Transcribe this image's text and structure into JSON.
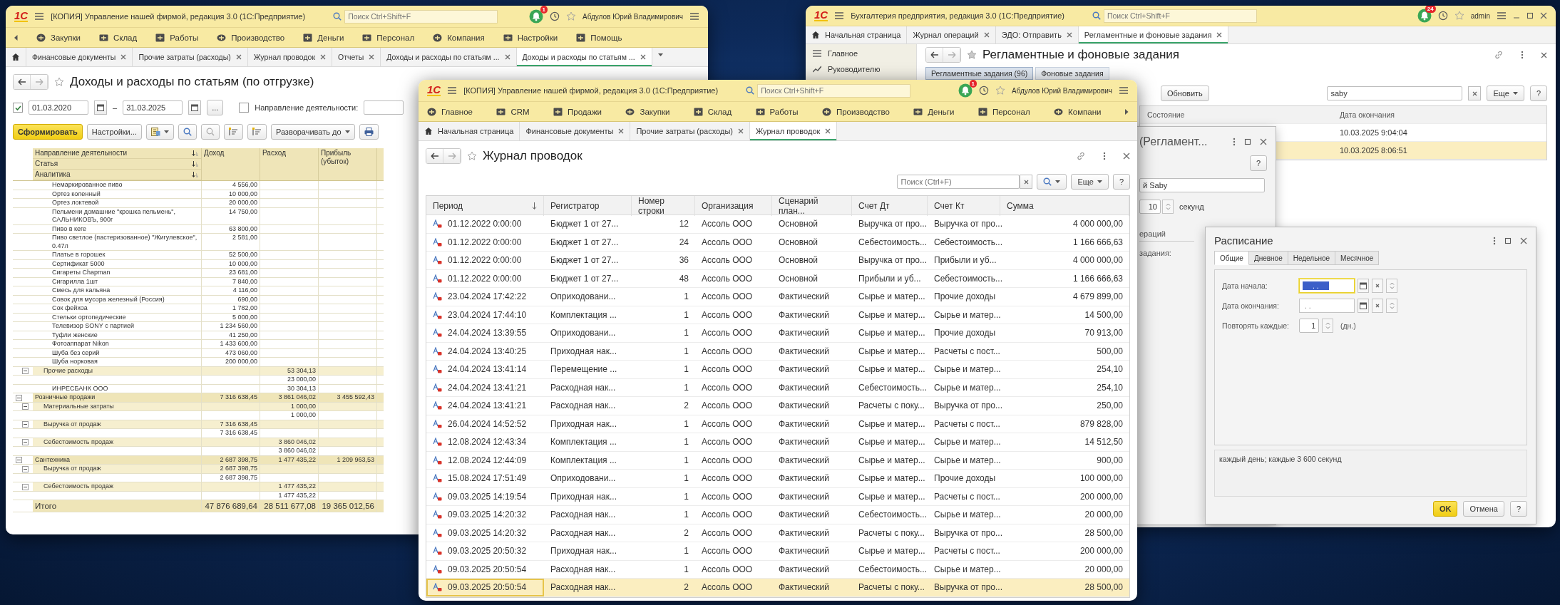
{
  "left_window": {
    "logo": "1С",
    "title": "[КОПИЯ] Управление нашей фирмой, редакция 3.0  (1С:Предприятие)",
    "search": {
      "placeholder": "Поиск Ctrl+Shift+F"
    },
    "notifications": "1",
    "user": "Абдулов Юрий Владимирович",
    "sections": [
      "Закупки",
      "Склад",
      "Работы",
      "Производство",
      "Деньги",
      "Персонал",
      "Компания",
      "Настройки",
      "Помощь"
    ],
    "tabs": [
      {
        "label": "Финансовые документы",
        "selected": false
      },
      {
        "label": "Прочие затраты (расходы)",
        "selected": false
      },
      {
        "label": "Журнал проводок",
        "selected": false
      },
      {
        "label": "Отчеты",
        "selected": false
      },
      {
        "label": "Доходы и расходы по статьям ...",
        "selected": false
      },
      {
        "label": "Доходы и расходы по статьям ...",
        "selected": true
      }
    ],
    "form_title": "Доходы и расходы по статьям (по отгрузке)",
    "period": {
      "checked": true,
      "start": "01.03.2020",
      "separator": "–",
      "end": "31.03.2025",
      "choose": "..."
    },
    "filter": {
      "checked": false,
      "label": "Направление деятельности:"
    },
    "toolbar": {
      "generate": "Сформировать",
      "settings": "Настройки...",
      "expand": "Разворачивать до"
    },
    "report": {
      "groupings": [
        "Направление деятельности",
        "Статья",
        "Аналитика"
      ],
      "columns": [
        "Доход",
        "Расход",
        "Прибыль (убыток)"
      ],
      "rows": [
        {
          "children": [
            {
              "children": [
                {
                  "label": "Немаркированное пиво",
                  "income": "4 556,00"
                },
                {
                  "label": "Ортез коленный",
                  "income": "10 000,00"
                },
                {
                  "label": "Ортез локтевой",
                  "income": "20 000,00"
                },
                {
                  "label": "Пельмени домашние \"крошка пельмень\", САЛЬНИКОВЪ, 900г",
                  "income": "14 750,00"
                },
                {
                  "label": "Пиво в кеге",
                  "income": "63 800,00"
                },
                {
                  "label": "Пиво светлое (пастеризованное) \"Жигулевское\", 0.47л",
                  "income": "2 581,00"
                },
                {
                  "label": "Платье в горошек",
                  "income": "52 500,00"
                },
                {
                  "label": "Сертификат 5000",
                  "income": "10 000,00"
                },
                {
                  "label": "Сигареты Chapman",
                  "income": "23 681,00"
                },
                {
                  "label": "Сигарилла 1шт",
                  "income": "7 840,00"
                },
                {
                  "label": "Смесь для кальяна",
                  "income": "4 116,00"
                },
                {
                  "label": "Совок для мусора железный (Россия)",
                  "income": "690,00"
                },
                {
                  "label": "Сок фейхоа",
                  "income": "1 782,00"
                },
                {
                  "label": "Стельки ортопедические",
                  "income": "5 000,00"
                },
                {
                  "label": "Телевизор SONY с партией",
                  "income": "1 234 560,00"
                },
                {
                  "label": "Туфли женские",
                  "income": "41 250,00"
                },
                {
                  "label": "Фотоаппарат Nikon",
                  "income": "1 433 600,00"
                },
                {
                  "label": "Шуба без серий",
                  "income": "473 060,00"
                },
                {
                  "label": "Шуба норковая",
                  "income": "200 000,00"
                }
              ]
            },
            {
              "label": "Прочие расходы",
              "expense": "53 304,13",
              "expanded": true,
              "children": [
                {
                  "expense": "23 000,00"
                },
                {
                  "label": "ИНРЕСБАНК ООО",
                  "expense": "30 304,13"
                }
              ]
            }
          ]
        },
        {
          "label": "Розничные продажи",
          "income": "7 316 638,45",
          "expense": "3 861 046,02",
          "profit": "3 455 592,43",
          "expanded": true,
          "children": [
            {
              "label": "Материальные затраты",
              "expense": "1 000,00",
              "expanded": true,
              "children": [
                {
                  "expense": "1 000,00"
                }
              ]
            },
            {
              "label": "Выручка от продаж",
              "income": "7 316 638,45",
              "expanded": true,
              "children": [
                {
                  "income": "7 316 638,45"
                }
              ]
            },
            {
              "label": "Себестоимость продаж",
              "expense": "3 860 046,02",
              "expanded": true,
              "children": [
                {
                  "expense": "3 860 046,02"
                }
              ]
            }
          ]
        },
        {
          "label": "Сантехника",
          "income": "2 687 398,75",
          "expense": "1 477 435,22",
          "profit": "1 209 963,53",
          "expanded": true,
          "children": [
            {
              "label": "Выручка от продаж",
              "income": "2 687 398,75",
              "expanded": true,
              "children": [
                {
                  "income": "2 687 398,75"
                }
              ]
            },
            {
              "label": "Себестоимость продаж",
              "expense": "1 477 435,22",
              "expanded": true,
              "children": [
                {
                  "expense": "1 477 435,22"
                }
              ]
            }
          ]
        }
      ],
      "total": {
        "label": "Итого",
        "income": "47 876 689,64",
        "expense": "28 511 677,08",
        "profit": "19 365 012,56"
      }
    }
  },
  "central_window": {
    "logo": "1С",
    "title": "[КОПИЯ] Управление нашей фирмой, редакция 3.0  (1С:Предприятие)",
    "search": {
      "placeholder": "Поиск Ctrl+Shift+F"
    },
    "notifications": "1",
    "user": "Абдулов Юрий Владимирович",
    "sections": [
      "Главное",
      "CRM",
      "Продажи",
      "Закупки",
      "Склад",
      "Работы",
      "Производство",
      "Деньги",
      "Персонал",
      "Компани"
    ],
    "home_tab": "Начальная страница",
    "tabs": [
      {
        "label": "Финансовые документы",
        "selected": false
      },
      {
        "label": "Прочие затраты (расходы)",
        "selected": false
      },
      {
        "label": "Журнал проводок",
        "selected": true
      }
    ],
    "form_title": "Журнал проводок",
    "list_search": {
      "placeholder": "Поиск (Ctrl+F)"
    },
    "more": "Еще",
    "help": "?",
    "columns": [
      {
        "label": "Период",
        "sorted": true
      },
      {
        "label": "Регистратор"
      },
      {
        "label": "Номер строки"
      },
      {
        "label": "Организация"
      },
      {
        "label": "Сценарий план..."
      },
      {
        "label": "Счет Дт"
      },
      {
        "label": "Счет Кт"
      },
      {
        "label": "Сумма"
      }
    ],
    "rows": [
      {
        "cells": [
          "01.12.2022 0:00:00",
          "Бюджет 1 от 27...",
          "12",
          "Ассоль ООО",
          "Основной",
          "Выручка от про...",
          "Выручка от про...",
          "4 000 000,00"
        ],
        "selected": false
      },
      {
        "cells": [
          "01.12.2022 0:00:00",
          "Бюджет 1 от 27...",
          "24",
          "Ассоль ООО",
          "Основной",
          "Себестоимость...",
          "Себестоимость...",
          "1 166 666,63"
        ],
        "selected": false
      },
      {
        "cells": [
          "01.12.2022 0:00:00",
          "Бюджет 1 от 27...",
          "36",
          "Ассоль ООО",
          "Основной",
          "Выручка от про...",
          "Прибыли и уб...",
          "4 000 000,00"
        ],
        "selected": false
      },
      {
        "cells": [
          "01.12.2022 0:00:00",
          "Бюджет 1 от 27...",
          "48",
          "Ассоль ООО",
          "Основной",
          "Прибыли и уб...",
          "Себестоимость...",
          "1 166 666,63"
        ],
        "selected": false
      },
      {
        "cells": [
          "23.04.2024 17:42:22",
          "Оприходовани...",
          "1",
          "Ассоль ООО",
          "Фактический",
          "Сырье и матер...",
          "Прочие доходы",
          "4 679 899,00"
        ],
        "selected": false
      },
      {
        "cells": [
          "23.04.2024 17:44:10",
          "Комплектация ...",
          "1",
          "Ассоль ООО",
          "Фактический",
          "Сырье и матер...",
          "Сырье и матер...",
          "14 500,00"
        ],
        "selected": false
      },
      {
        "cells": [
          "24.04.2024 13:39:55",
          "Оприходовани...",
          "1",
          "Ассоль ООО",
          "Фактический",
          "Сырье и матер...",
          "Прочие доходы",
          "70 913,00"
        ],
        "selected": false
      },
      {
        "cells": [
          "24.04.2024 13:40:25",
          "Приходная нак...",
          "1",
          "Ассоль ООО",
          "Фактический",
          "Сырье и матер...",
          "Расчеты с пост...",
          "500,00"
        ],
        "selected": false
      },
      {
        "cells": [
          "24.04.2024 13:41:14",
          "Перемещение ...",
          "1",
          "Ассоль ООО",
          "Фактический",
          "Сырье и матер...",
          "Сырье и матер...",
          "254,10"
        ],
        "selected": false
      },
      {
        "cells": [
          "24.04.2024 13:41:21",
          "Расходная нак...",
          "1",
          "Ассоль ООО",
          "Фактический",
          "Себестоимость...",
          "Сырье и матер...",
          "254,10"
        ],
        "selected": false
      },
      {
        "cells": [
          "24.04.2024 13:41:21",
          "Расходная нак...",
          "2",
          "Ассоль ООО",
          "Фактический",
          "Расчеты с поку...",
          "Выручка от про...",
          "250,00"
        ],
        "selected": false
      },
      {
        "cells": [
          "26.04.2024 14:52:52",
          "Приходная нак...",
          "1",
          "Ассоль ООО",
          "Фактический",
          "Сырье и матер...",
          "Расчеты с пост...",
          "879 828,00"
        ],
        "selected": false
      },
      {
        "cells": [
          "12.08.2024 12:43:34",
          "Комплектация ...",
          "1",
          "Ассоль ООО",
          "Фактический",
          "Сырье и матер...",
          "Сырье и матер...",
          "14 512,50"
        ],
        "selected": false
      },
      {
        "cells": [
          "12.08.2024 12:44:09",
          "Комплектация ...",
          "1",
          "Ассоль ООО",
          "Фактический",
          "Сырье и матер...",
          "Сырье и матер...",
          "900,00"
        ],
        "selected": false
      },
      {
        "cells": [
          "15.08.2024 17:51:49",
          "Оприходовани...",
          "1",
          "Ассоль ООО",
          "Фактический",
          "Сырье и матер...",
          "Прочие доходы",
          "100 000,00"
        ],
        "selected": false
      },
      {
        "cells": [
          "09.03.2025 14:19:54",
          "Приходная нак...",
          "1",
          "Ассоль ООО",
          "Фактический",
          "Сырье и матер...",
          "Расчеты с пост...",
          "200 000,00"
        ],
        "selected": false
      },
      {
        "cells": [
          "09.03.2025 14:20:32",
          "Расходная нак...",
          "1",
          "Ассоль ООО",
          "Фактический",
          "Себестоимость...",
          "Сырье и матер...",
          "20 000,00"
        ],
        "selected": false
      },
      {
        "cells": [
          "09.03.2025 14:20:32",
          "Расходная нак...",
          "2",
          "Ассоль ООО",
          "Фактический",
          "Расчеты с поку...",
          "Выручка от про...",
          "28 500,00"
        ],
        "selected": false
      },
      {
        "cells": [
          "09.03.2025 20:50:32",
          "Приходная нак...",
          "1",
          "Ассоль ООО",
          "Фактический",
          "Сырье и матер...",
          "Расчеты с пост...",
          "200 000,00"
        ],
        "selected": false
      },
      {
        "cells": [
          "09.03.2025 20:50:54",
          "Расходная нак...",
          "1",
          "Ассоль ООО",
          "Фактический",
          "Себестоимость...",
          "Сырье и матер...",
          "20 000,00"
        ],
        "selected": false
      },
      {
        "cells": [
          "09.03.2025 20:50:54",
          "Расходная нак...",
          "2",
          "Ассоль ООО",
          "Фактический",
          "Расчеты с поку...",
          "Выручка от про...",
          "28 500,00"
        ],
        "selected": true
      }
    ]
  },
  "right_window": {
    "logo": "1С",
    "title": "Бухгалтерия предприятия, редакция 3.0  (1С:Предприятие)",
    "search": {
      "placeholder": "Поиск Ctrl+Shift+F"
    },
    "notifications": "24",
    "user": "admin",
    "home_tab": "Начальная страница",
    "tabs": [
      {
        "label": "Журнал операций",
        "selected": false
      },
      {
        "label": "ЭДО: Отправить",
        "selected": false
      },
      {
        "label": "Регламентные и фоновые задания",
        "selected": true
      }
    ],
    "sidebar": [
      {
        "label": "Главное"
      },
      {
        "label": "Руководителю"
      }
    ],
    "form_title": "Регламентные и фоновые задания",
    "subtabs": [
      {
        "label": "Регламентные задания (96)",
        "selected": true
      },
      {
        "label": "Фоновые задания",
        "selected": false
      }
    ],
    "refresh": "Обновить",
    "search_value": "saby",
    "more": "Еще",
    "help": "?",
    "columns": [
      "Состояние",
      "Дата окончания"
    ],
    "rows": [
      {
        "end": "10.03.2025 9:04:04",
        "selected": false
      },
      {
        "end": "10.03.2025 8:06:51",
        "selected": true
      }
    ],
    "job_dialog": {
      "title": "(Регламент...",
      "help": "?",
      "name": "й Saby",
      "interval": "10",
      "interval_unit": "секунд",
      "section": "ераций",
      "label": "задания:"
    },
    "schedule_dialog": {
      "title": "Расписание",
      "tabs": [
        {
          "label": "Общие",
          "selected": true
        },
        {
          "label": "Дневное",
          "selected": false
        },
        {
          "label": "Недельное",
          "selected": false
        },
        {
          "label": "Месячное",
          "selected": false
        }
      ],
      "fields": [
        {
          "label": "Дата начала:",
          "value": ". .",
          "highlighted": true
        },
        {
          "label": "Дата окончания:",
          "value": ". .",
          "highlighted": false
        }
      ],
      "repeat": {
        "label": "Повторять каждые:",
        "value": "1",
        "unit": "(дн.)"
      },
      "summary": "каждый день; каждые 3 600 секунд",
      "buttons": [
        {
          "label": "OK",
          "kind": "default"
        },
        {
          "label": "Отмена",
          "kind": "normal"
        },
        {
          "label": "?",
          "kind": "normal"
        }
      ]
    }
  }
}
